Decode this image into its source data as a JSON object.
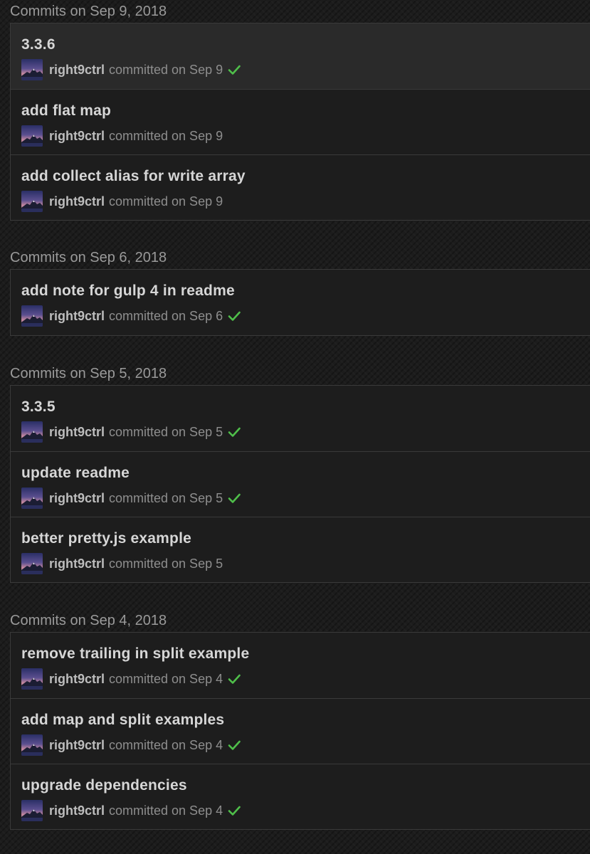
{
  "colors": {
    "background": "#1c1c1c",
    "list_background": "#1d1d1d",
    "selected_row": "#2a2a2a",
    "border": "#3a3a3a",
    "success": "#4fbf4a"
  },
  "groups": [
    {
      "heading": "Commits on Sep 9, 2018",
      "commits": [
        {
          "title": "3.3.6",
          "author": "right9ctrl",
          "action": "committed on Sep 9",
          "status": "success",
          "selected": true
        },
        {
          "title": "add flat map",
          "author": "right9ctrl",
          "action": "committed on Sep 9",
          "status": "none"
        },
        {
          "title": "add collect alias for write array",
          "author": "right9ctrl",
          "action": "committed on Sep 9",
          "status": "none"
        }
      ]
    },
    {
      "heading": "Commits on Sep 6, 2018",
      "commits": [
        {
          "title": "add note for gulp 4 in readme",
          "author": "right9ctrl",
          "action": "committed on Sep 6",
          "status": "success"
        }
      ]
    },
    {
      "heading": "Commits on Sep 5, 2018",
      "commits": [
        {
          "title": "3.3.5",
          "author": "right9ctrl",
          "action": "committed on Sep 5",
          "status": "success"
        },
        {
          "title": "update readme",
          "author": "right9ctrl",
          "action": "committed on Sep 5",
          "status": "success"
        },
        {
          "title": "better pretty.js example",
          "author": "right9ctrl",
          "action": "committed on Sep 5",
          "status": "none"
        }
      ]
    },
    {
      "heading": "Commits on Sep 4, 2018",
      "commits": [
        {
          "title": "remove trailing in split example",
          "author": "right9ctrl",
          "action": "committed on Sep 4",
          "status": "success"
        },
        {
          "title": "add map and split examples",
          "author": "right9ctrl",
          "action": "committed on Sep 4",
          "status": "success"
        },
        {
          "title": "upgrade dependencies",
          "author": "right9ctrl",
          "action": "committed on Sep 4",
          "status": "success"
        }
      ]
    }
  ]
}
